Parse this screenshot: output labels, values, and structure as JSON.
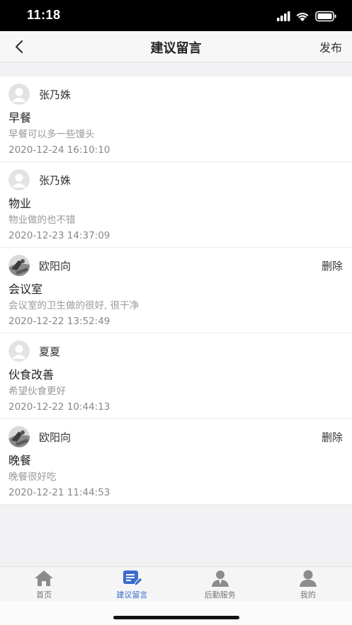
{
  "status_bar": {
    "time": "11:18"
  },
  "header": {
    "title": "建议留言",
    "publish_label": "发布"
  },
  "posts": [
    {
      "author": "张乃姝",
      "title": "早餐",
      "content": "早餐可以多一些馒头",
      "time": "2020-12-24 16:10:10",
      "avatar": "default-avatar-icon",
      "deletable": false
    },
    {
      "author": "张乃姝",
      "title": "物业",
      "content": "物业做的也不错",
      "time": "2020-12-23 14:37:09",
      "avatar": "default-avatar-icon",
      "deletable": false
    },
    {
      "author": "欧阳向",
      "title": "会议室",
      "content": "会议室的卫生做的很好, 很干净",
      "time": "2020-12-22 13:52:49",
      "avatar": "photo-avatar",
      "deletable": true,
      "delete_label": "删除"
    },
    {
      "author": "夏夏",
      "title": "伙食改善",
      "content": "希望伙食更好",
      "time": "2020-12-22 10:44:13",
      "avatar": "default-avatar-icon",
      "deletable": false
    },
    {
      "author": "欧阳向",
      "title": "晚餐",
      "content": "晚餐很好吃",
      "time": "2020-12-21 11:44:53",
      "avatar": "photo-avatar",
      "deletable": true,
      "delete_label": "删除"
    }
  ],
  "tab_bar": {
    "items": [
      {
        "label": "首页",
        "icon": "home-icon",
        "active": false
      },
      {
        "label": "建议留言",
        "icon": "message-edit-icon",
        "active": true
      },
      {
        "label": "后勤服务",
        "icon": "service-person-icon",
        "active": false
      },
      {
        "label": "我的",
        "icon": "profile-icon",
        "active": false
      }
    ]
  },
  "colors": {
    "accent": "#3a6ccd",
    "background": "#f2f2f4",
    "muted_text": "#999999"
  }
}
